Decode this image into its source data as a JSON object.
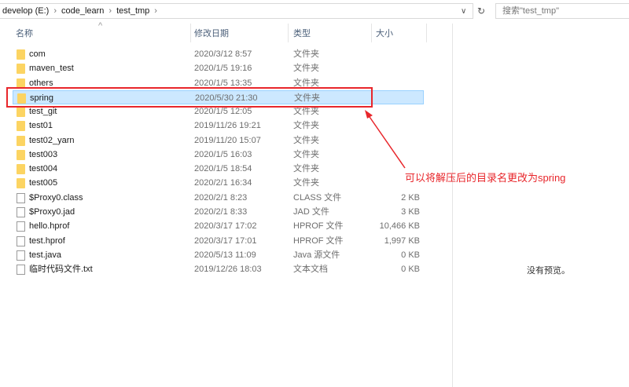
{
  "breadcrumb": [
    "develop (E:)",
    "code_learn",
    "test_tmp"
  ],
  "search_placeholder": "搜索\"test_tmp\"",
  "columns": {
    "name": "名称",
    "date": "修改日期",
    "type": "类型",
    "size": "大小"
  },
  "files": [
    {
      "name": "com",
      "date": "2020/3/12 8:57",
      "type": "文件夹",
      "size": "",
      "kind": "folder"
    },
    {
      "name": "maven_test",
      "date": "2020/1/5 19:16",
      "type": "文件夹",
      "size": "",
      "kind": "folder"
    },
    {
      "name": "others",
      "date": "2020/1/5 13:35",
      "type": "文件夹",
      "size": "",
      "kind": "folder"
    },
    {
      "name": "spring",
      "date": "2020/5/30 21:30",
      "type": "文件夹",
      "size": "",
      "kind": "folder",
      "selected": true
    },
    {
      "name": "test_git",
      "date": "2020/1/5 12:05",
      "type": "文件夹",
      "size": "",
      "kind": "folder"
    },
    {
      "name": "test01",
      "date": "2019/11/26 19:21",
      "type": "文件夹",
      "size": "",
      "kind": "folder"
    },
    {
      "name": "test02_yarn",
      "date": "2019/11/20 15:07",
      "type": "文件夹",
      "size": "",
      "kind": "folder"
    },
    {
      "name": "test003",
      "date": "2020/1/5 16:03",
      "type": "文件夹",
      "size": "",
      "kind": "folder"
    },
    {
      "name": "test004",
      "date": "2020/1/5 18:54",
      "type": "文件夹",
      "size": "",
      "kind": "folder"
    },
    {
      "name": "test005",
      "date": "2020/2/1 16:34",
      "type": "文件夹",
      "size": "",
      "kind": "folder"
    },
    {
      "name": "$Proxy0.class",
      "date": "2020/2/1 8:23",
      "type": "CLASS 文件",
      "size": "2 KB",
      "kind": "file"
    },
    {
      "name": "$Proxy0.jad",
      "date": "2020/2/1 8:33",
      "type": "JAD 文件",
      "size": "3 KB",
      "kind": "file"
    },
    {
      "name": "hello.hprof",
      "date": "2020/3/17 17:02",
      "type": "HPROF 文件",
      "size": "10,466 KB",
      "kind": "file"
    },
    {
      "name": "test.hprof",
      "date": "2020/3/17 17:01",
      "type": "HPROF 文件",
      "size": "1,997 KB",
      "kind": "file"
    },
    {
      "name": "test.java",
      "date": "2020/5/13 11:09",
      "type": "Java 源文件",
      "size": "0 KB",
      "kind": "file"
    },
    {
      "name": "临时代码文件.txt",
      "date": "2019/12/26 18:03",
      "type": "文本文档",
      "size": "0 KB",
      "kind": "file"
    }
  ],
  "preview_text": "没有预览。",
  "annotation": "可以将解压后的目录名更改为spring"
}
